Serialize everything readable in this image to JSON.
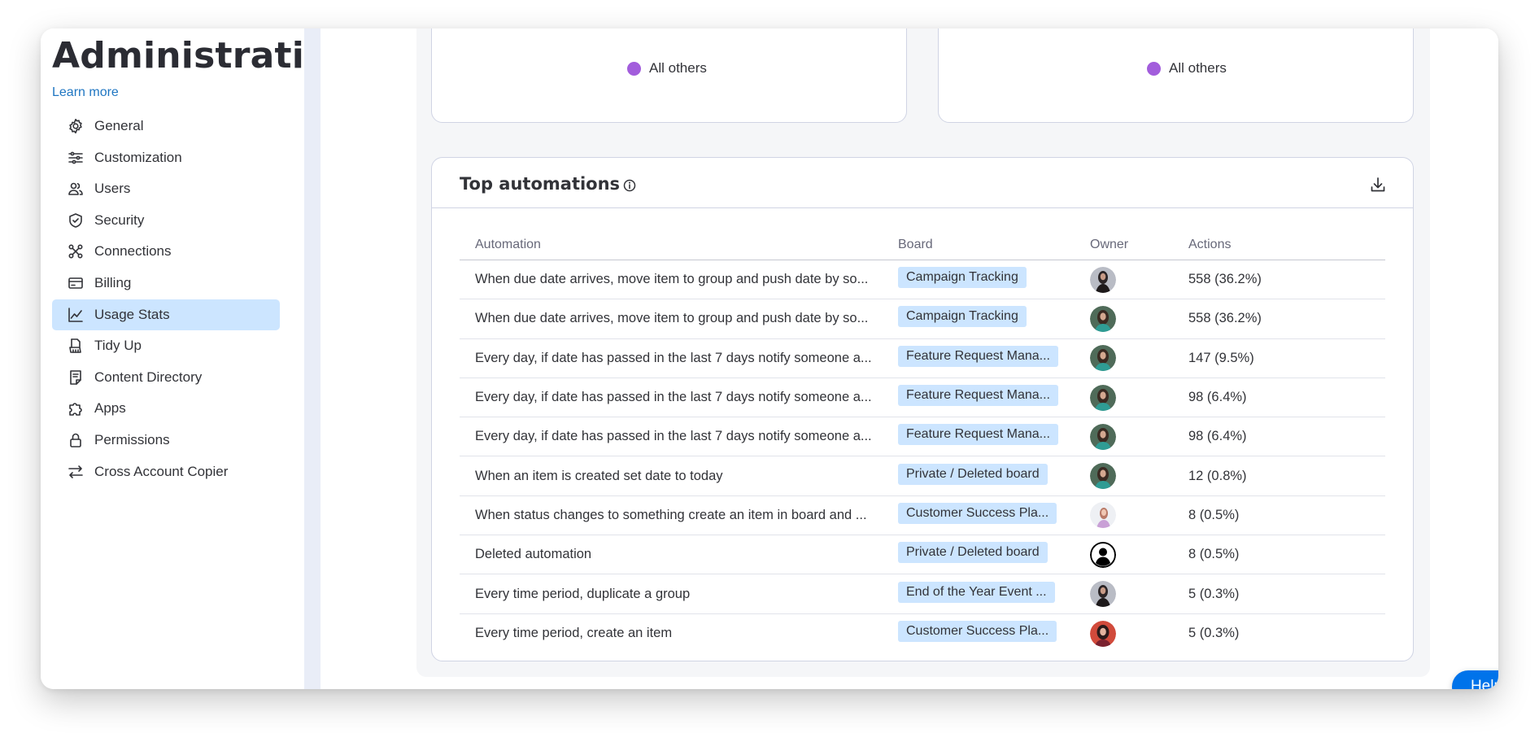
{
  "sidebar": {
    "title": "Administration",
    "learn_more": "Learn more",
    "items": [
      {
        "label": "General",
        "icon": "gear-icon"
      },
      {
        "label": "Customization",
        "icon": "sliders-icon"
      },
      {
        "label": "Users",
        "icon": "users-icon"
      },
      {
        "label": "Security",
        "icon": "shield-icon"
      },
      {
        "label": "Connections",
        "icon": "connections-icon"
      },
      {
        "label": "Billing",
        "icon": "credit-card-icon"
      },
      {
        "label": "Usage Stats",
        "icon": "chart-line-icon",
        "active": true
      },
      {
        "label": "Tidy Up",
        "icon": "broom-icon"
      },
      {
        "label": "Content Directory",
        "icon": "document-icon"
      },
      {
        "label": "Apps",
        "icon": "puzzle-icon"
      },
      {
        "label": "Permissions",
        "icon": "lock-icon"
      },
      {
        "label": "Cross Account Copier",
        "icon": "arrows-icon"
      }
    ]
  },
  "legends": {
    "left": {
      "label": "All others",
      "color": "#a25ddc"
    },
    "right": {
      "label": "All others",
      "color": "#a25ddc"
    }
  },
  "top_automations": {
    "title": "Top automations",
    "columns": {
      "automation": "Automation",
      "board": "Board",
      "owner": "Owner",
      "actions": "Actions"
    },
    "rows": [
      {
        "automation": "When due date arrives, move item to group and push date by so...",
        "board": "Campaign Tracking",
        "actions": "558 (36.2%)",
        "owner_style": "dark"
      },
      {
        "automation": "When due date arrives, move item to group and push date by so...",
        "board": "Campaign Tracking",
        "actions": "558 (36.2%)",
        "owner_style": "teal"
      },
      {
        "automation": "Every day, if date has passed in the last 7 days notify someone a...",
        "board": "Feature Request Mana...",
        "actions": "147 (9.5%)",
        "owner_style": "teal"
      },
      {
        "automation": "Every day, if date has passed in the last 7 days notify someone a...",
        "board": "Feature Request Mana...",
        "actions": "98 (6.4%)",
        "owner_style": "teal"
      },
      {
        "automation": "Every day, if date has passed in the last 7 days notify someone a...",
        "board": "Feature Request Mana...",
        "actions": "98 (6.4%)",
        "owner_style": "teal"
      },
      {
        "automation": "When an item is created set date to today",
        "board": "Private / Deleted board",
        "actions": "12 (0.8%)",
        "owner_style": "teal"
      },
      {
        "automation": "When status changes to something create an item in board and ...",
        "board": "Customer Success Pla...",
        "actions": "8 (0.5%)",
        "owner_style": "light"
      },
      {
        "automation": "Deleted automation",
        "board": "Private / Deleted board",
        "actions": "8 (0.5%)",
        "owner_style": "placeholder"
      },
      {
        "automation": "Every time period, duplicate a group",
        "board": "End of the Year Event ...",
        "actions": "5 (0.3%)",
        "owner_style": "dark"
      },
      {
        "automation": "Every time period, create an item",
        "board": "Customer Success Pla...",
        "actions": "5 (0.3%)",
        "owner_style": "red"
      }
    ]
  },
  "help": {
    "label": "Help"
  }
}
